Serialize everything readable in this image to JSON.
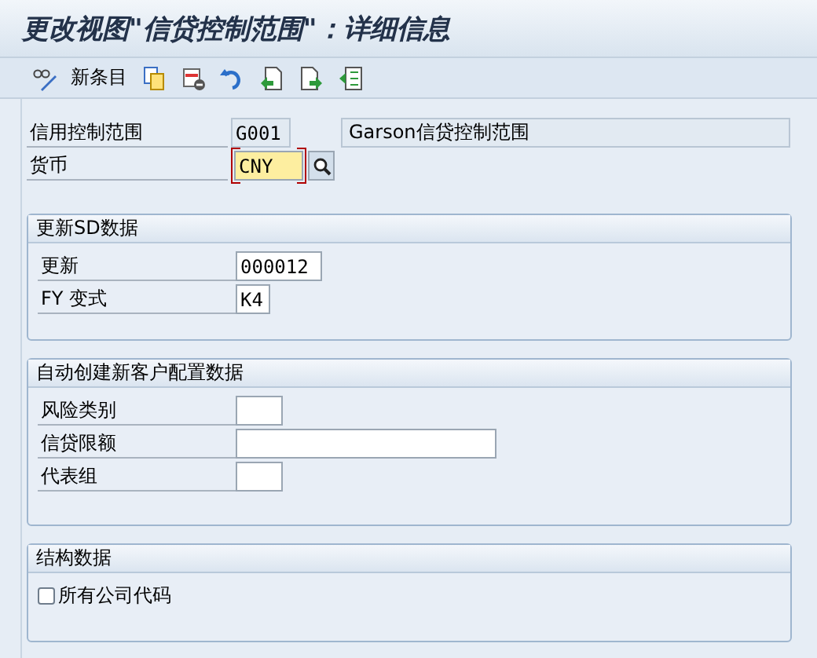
{
  "window": {
    "title": "更改视图\"信贷控制范围\"：详细信息"
  },
  "toolbar": {
    "new_entries_label": "新条目"
  },
  "header_fields": [
    {
      "label": "信用控制范围",
      "value": "G001",
      "kind": "readonly",
      "description": "Garson信贷控制范围",
      "search": false
    },
    {
      "label": "货币",
      "value": "CNY",
      "kind": "focused",
      "search": true
    }
  ],
  "groups": [
    {
      "title": "更新SD数据",
      "items": [
        {
          "kind": "field-m",
          "label": "更新",
          "value": "000012"
        },
        {
          "kind": "field-xs",
          "label": "FY 变式",
          "value": "K4"
        }
      ]
    },
    {
      "title": "自动创建新客户配置数据",
      "items": [
        {
          "kind": "field-s",
          "label": "风险类别"
        },
        {
          "kind": "field-l",
          "label": "信贷限额"
        },
        {
          "kind": "field-s",
          "label": "代表组"
        }
      ]
    },
    {
      "title": "结构数据",
      "items": [
        {
          "kind": "checkbox",
          "label": "所有公司代码",
          "checked": false
        }
      ]
    }
  ]
}
